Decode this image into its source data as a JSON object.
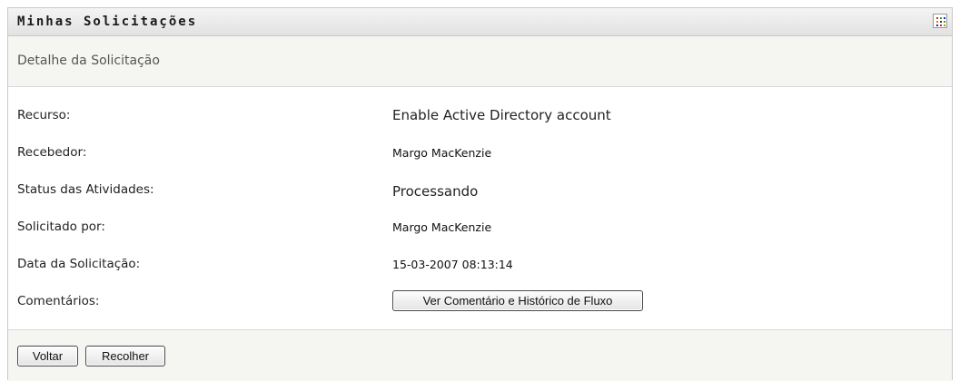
{
  "portlet": {
    "title": "Minhas Solicitações",
    "subtitle": "Detalhe da Solicitação"
  },
  "details": {
    "resource": {
      "label": "Recurso:",
      "value": "Enable Active Directory account"
    },
    "recipient": {
      "label": "Recebedor:",
      "value": "Margo MacKenzie"
    },
    "activity_status": {
      "label": "Status das Atividades:",
      "value": "Processando"
    },
    "requested_by": {
      "label": "Solicitado por:",
      "value": "Margo MacKenzie"
    },
    "request_date": {
      "label": "Data da Solicitação:",
      "value": "15-03-2007 08:13:14"
    },
    "comments": {
      "label": "Comentários:",
      "button_label": "Ver Comentário e Histórico de Fluxo"
    }
  },
  "footer": {
    "back_label": "Voltar",
    "retract_label": "Recolher"
  },
  "icons": {
    "menu": "grid-menu-icon"
  }
}
